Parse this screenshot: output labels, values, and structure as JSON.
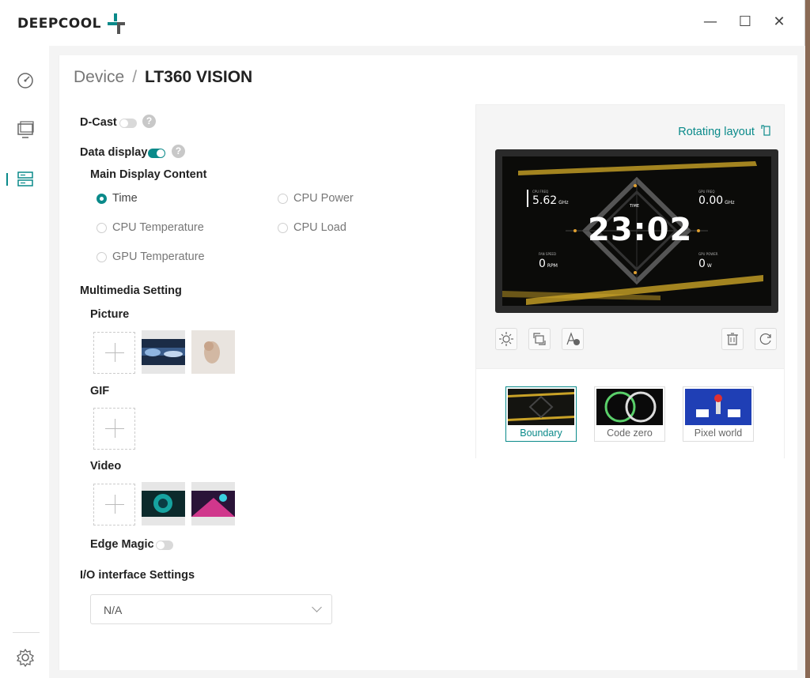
{
  "app": {
    "logo_text": "DEEPCOOL",
    "window_controls": {
      "minimize": "—",
      "maximize": "☐",
      "close": "✕"
    }
  },
  "breadcrumb": {
    "parent": "Device",
    "separator": "/",
    "current": "LT360 VISION"
  },
  "settings": {
    "dcast_label": "D-Cast",
    "dcast_on": false,
    "data_display_label": "Data display",
    "data_display_on": true,
    "main_display_content_label": "Main Display Content",
    "options": [
      {
        "label": "Time",
        "selected": true
      },
      {
        "label": "CPU Power",
        "selected": false
      },
      {
        "label": "CPU Temperature",
        "selected": false
      },
      {
        "label": "CPU Load",
        "selected": false
      },
      {
        "label": "GPU Temperature",
        "selected": false
      }
    ],
    "multimedia_label": "Multimedia Setting",
    "picture_label": "Picture",
    "gif_label": "GIF",
    "video_label": "Video",
    "edge_magic_label": "Edge Magic",
    "edge_magic_on": false,
    "io_label": "I/O interface Settings",
    "io_value": "N/A"
  },
  "preview": {
    "rotating_layout": "Rotating layout",
    "screen": {
      "cpu_freq_label": "CPU FREQ",
      "cpu_freq_value": "5.62",
      "cpu_freq_unit": "GHz",
      "gpu_freq_label": "GPU FREQ",
      "gpu_freq_value": "0.00",
      "gpu_freq_unit": "GHz",
      "time_label": "TIME",
      "time_value": "23:02",
      "fan_label": "FAN SPEED",
      "fan_value": "0",
      "fan_unit": "RPM",
      "gpu_power_label": "GPU POWER",
      "gpu_power_value": "0",
      "gpu_power_unit": "W"
    },
    "themes": [
      {
        "name": "Boundary",
        "selected": true
      },
      {
        "name": "Code zero",
        "selected": false
      },
      {
        "name": "Pixel world",
        "selected": false
      }
    ]
  },
  "colors": {
    "accent": "#0a8a8a",
    "warning_tape": "#c9a227"
  },
  "icons": [
    "dashboard-icon",
    "monitor-icon",
    "device-list-icon",
    "settings-gear-icon",
    "brightness-icon",
    "rotate-icon",
    "text-style-icon",
    "delete-icon",
    "refresh-icon",
    "rotate-layout-icon"
  ]
}
